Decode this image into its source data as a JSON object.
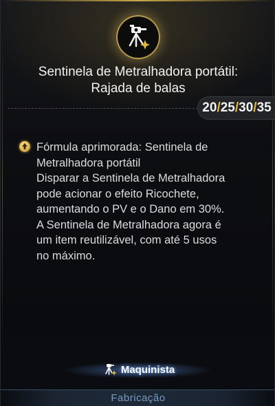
{
  "skill": {
    "icon": "turret-icon",
    "title_line1": "Sentinela de Metralhadora portátil:",
    "title_line2": "Rajada de balas"
  },
  "levels": {
    "l1": "20",
    "sep1": "/",
    "l2": "25",
    "sep2": "/",
    "l3": "30",
    "sep3": "/",
    "l4": "35"
  },
  "upgrade": {
    "icon": "upgrade-arrow-icon",
    "lines": [
      "Fórmula aprimorada: Sentinela de",
      "Metralhadora portátil",
      "Disparar a Sentinela de Metralhadora",
      "pode acionar o efeito Ricochete,",
      "aumentando o PV e o Dano em 30%.",
      "A Sentinela de Metralhadora agora é",
      "um item reutilizável, com até 5 usos",
      "no máximo."
    ]
  },
  "class_tag": {
    "icon": "turret-icon",
    "label": "Maquinista"
  },
  "footer": {
    "label": "Fabricação"
  },
  "colors": {
    "accent_gold": "#e3b93c",
    "footer_blue": "#7a9cc4"
  }
}
